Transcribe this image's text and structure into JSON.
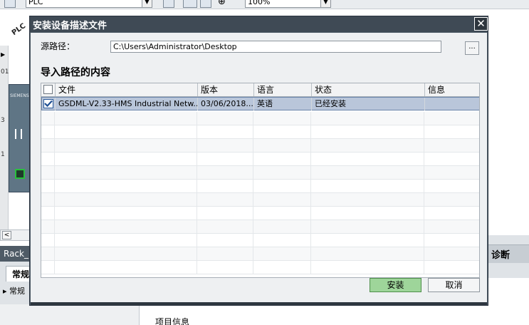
{
  "background": {
    "toolbar": {
      "device_combo_value": "PLC",
      "zoom_combo_value": "100%"
    },
    "canvas_label": "PLC",
    "left_numbers": [
      "01",
      "3",
      "1"
    ],
    "module_brand": "SIEMENS",
    "rack_tab": "Rack_",
    "general_tab": "常规",
    "tree_item": "常规",
    "diagnostics_tab": "诊断",
    "project_info": "项目信息"
  },
  "dialog": {
    "title": "安装设备描述文件",
    "close_symbol": "✕",
    "source_path_label": "源路径：",
    "source_path_value": "C:\\Users\\Administrator\\Desktop",
    "browse_label": "...",
    "section_title": "导入路径的内容",
    "table": {
      "headers": [
        "文件",
        "版本",
        "语言",
        "状态",
        "信息"
      ],
      "rows": [
        {
          "checked": true,
          "file": "GSDML-V2.33-HMS Industrial Netw...",
          "version": "03/06/2018...",
          "language": "英语",
          "status": "已经安装",
          "info": ""
        }
      ]
    },
    "install_button": "安装",
    "cancel_button": "取消"
  }
}
